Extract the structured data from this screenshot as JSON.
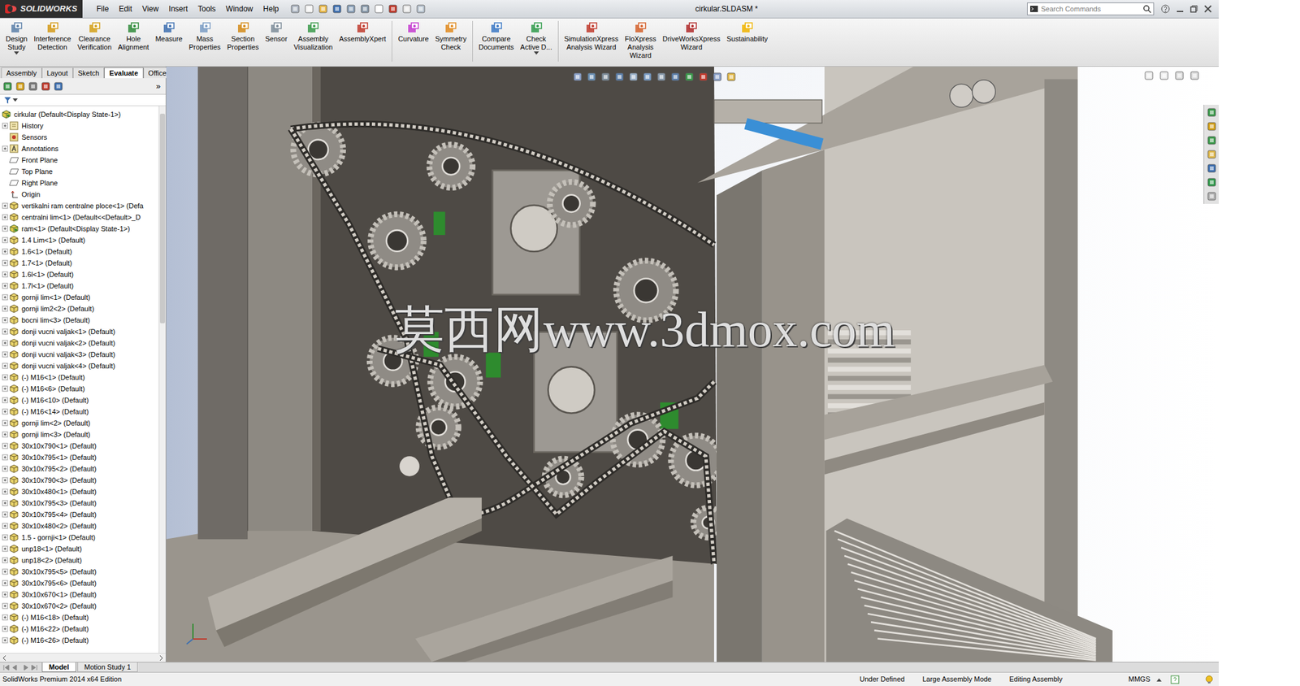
{
  "app": {
    "logo": "SOLIDWORKS",
    "title": "cirkular.SLDASM *"
  },
  "menu": [
    "File",
    "Edit",
    "View",
    "Insert",
    "Tools",
    "Window",
    "Help"
  ],
  "search": {
    "placeholder": "Search Commands"
  },
  "toolbar": [
    {
      "lines": [
        "Design",
        "Study"
      ],
      "dropdown": true,
      "separator_before": false
    },
    {
      "lines": [
        "Interference",
        "Detection"
      ],
      "dropdown": false,
      "separator_before": false
    },
    {
      "lines": [
        "Clearance",
        "Verification"
      ],
      "dropdown": false,
      "separator_before": false
    },
    {
      "lines": [
        "Hole",
        "Alignment"
      ],
      "dropdown": false,
      "separator_before": false
    },
    {
      "lines": [
        "Measure"
      ],
      "dropdown": false,
      "separator_before": false
    },
    {
      "lines": [
        "Mass",
        "Properties"
      ],
      "dropdown": false,
      "separator_before": false
    },
    {
      "lines": [
        "Section",
        "Properties"
      ],
      "dropdown": false,
      "separator_before": false
    },
    {
      "lines": [
        "Sensor"
      ],
      "dropdown": false,
      "separator_before": false
    },
    {
      "lines": [
        "Assembly",
        "Visualization"
      ],
      "dropdown": false,
      "separator_before": false
    },
    {
      "lines": [
        "AssemblyXpert"
      ],
      "dropdown": false,
      "separator_before": false
    },
    {
      "lines": [
        "Curvature"
      ],
      "dropdown": false,
      "separator_before": true
    },
    {
      "lines": [
        "Symmetry",
        "Check"
      ],
      "dropdown": false,
      "separator_before": false
    },
    {
      "lines": [
        "Compare",
        "Documents"
      ],
      "dropdown": false,
      "separator_before": true
    },
    {
      "lines": [
        "Check",
        "Active D..."
      ],
      "dropdown": true,
      "separator_before": false
    },
    {
      "lines": [
        "SimulationXpress",
        "Analysis Wizard"
      ],
      "dropdown": false,
      "separator_before": true
    },
    {
      "lines": [
        "FloXpress",
        "Analysis",
        "Wizard"
      ],
      "dropdown": false,
      "separator_before": false
    },
    {
      "lines": [
        "DriveWorksXpress",
        "Wizard"
      ],
      "dropdown": false,
      "separator_before": false
    },
    {
      "lines": [
        "Sustainability"
      ],
      "dropdown": false,
      "separator_before": false
    }
  ],
  "tabs": [
    {
      "label": "Assembly",
      "selected": false
    },
    {
      "label": "Layout",
      "selected": false
    },
    {
      "label": "Sketch",
      "selected": false
    },
    {
      "label": "Evaluate",
      "selected": true
    },
    {
      "label": "Office Products",
      "selected": false
    }
  ],
  "panel_overflow": "»",
  "tree": {
    "root": "cirkular  (Default<Display State-1>)",
    "items": [
      {
        "label": "History",
        "kind": "history",
        "expandable": true
      },
      {
        "label": "Sensors",
        "kind": "sensors",
        "expandable": false
      },
      {
        "label": "Annotations",
        "kind": "annotations",
        "expandable": true
      },
      {
        "label": "Front Plane",
        "kind": "plane",
        "expandable": false
      },
      {
        "label": "Top Plane",
        "kind": "plane",
        "expandable": false
      },
      {
        "label": "Right Plane",
        "kind": "plane",
        "expandable": false
      },
      {
        "label": "Origin",
        "kind": "origin",
        "expandable": false
      },
      {
        "label": "vertikalni ram centralne ploce<1> (Defa",
        "kind": "part",
        "expandable": true
      },
      {
        "label": "centralni lim<1> (Default<<Default>_D",
        "kind": "part",
        "expandable": true
      },
      {
        "label": "ram<1> (Default<Display State-1>)",
        "kind": "assembly",
        "expandable": true
      },
      {
        "label": "1.4 Lim<1> (Default)",
        "kind": "part",
        "expandable": true
      },
      {
        "label": "1.6<1> (Default)",
        "kind": "part",
        "expandable": true
      },
      {
        "label": "1.7<1> (Default)",
        "kind": "part",
        "expandable": true
      },
      {
        "label": "1.6l<1> (Default)",
        "kind": "part",
        "expandable": true
      },
      {
        "label": "1.7l<1> (Default)",
        "kind": "part",
        "expandable": true
      },
      {
        "label": "gornji lim<1> (Default)",
        "kind": "part",
        "expandable": true
      },
      {
        "label": "gornji lim2<2> (Default)",
        "kind": "part",
        "expandable": true
      },
      {
        "label": "bocni lim<3> (Default)",
        "kind": "part",
        "expandable": true
      },
      {
        "label": "donji vucni valjak<1> (Default)",
        "kind": "part",
        "expandable": true
      },
      {
        "label": "donji vucni valjak<2> (Default)",
        "kind": "part",
        "expandable": true
      },
      {
        "label": "donji vucni valjak<3> (Default)",
        "kind": "part",
        "expandable": true
      },
      {
        "label": "donji vucni valjak<4> (Default)",
        "kind": "part",
        "expandable": true
      },
      {
        "label": "(-) M16<1> (Default)",
        "kind": "part",
        "expandable": true
      },
      {
        "label": "(-) M16<6> (Default)",
        "kind": "part",
        "expandable": true
      },
      {
        "label": "(-) M16<10> (Default)",
        "kind": "part",
        "expandable": true
      },
      {
        "label": "(-) M16<14> (Default)",
        "kind": "part",
        "expandable": true
      },
      {
        "label": "gornji lim<2> (Default)",
        "kind": "part",
        "expandable": true
      },
      {
        "label": "gornji lim<3> (Default)",
        "kind": "part",
        "expandable": true
      },
      {
        "label": "30x10x790<1> (Default)",
        "kind": "part",
        "expandable": true
      },
      {
        "label": "30x10x795<1> (Default)",
        "kind": "part",
        "expandable": true
      },
      {
        "label": "30x10x795<2> (Default)",
        "kind": "part",
        "expandable": true
      },
      {
        "label": "30x10x790<3> (Default)",
        "kind": "part",
        "expandable": true
      },
      {
        "label": "30x10x480<1> (Default)",
        "kind": "part",
        "expandable": true
      },
      {
        "label": "30x10x795<3> (Default)",
        "kind": "part",
        "expandable": true
      },
      {
        "label": "30x10x795<4> (Default)",
        "kind": "part",
        "expandable": true
      },
      {
        "label": "30x10x480<2> (Default)",
        "kind": "part",
        "expandable": true
      },
      {
        "label": "1.5 - gornji<1> (Default)",
        "kind": "part",
        "expandable": true
      },
      {
        "label": "unp18<1> (Default)",
        "kind": "part",
        "expandable": true
      },
      {
        "label": "unp18<2> (Default)",
        "kind": "part",
        "expandable": true
      },
      {
        "label": "30x10x795<5> (Default)",
        "kind": "part",
        "expandable": true
      },
      {
        "label": "30x10x795<6> (Default)",
        "kind": "part",
        "expandable": true
      },
      {
        "label": "30x10x670<1> (Default)",
        "kind": "part",
        "expandable": true
      },
      {
        "label": "30x10x670<2> (Default)",
        "kind": "part",
        "expandable": true
      },
      {
        "label": "(-) M16<18> (Default)",
        "kind": "part",
        "expandable": true
      },
      {
        "label": "(-) M16<22> (Default)",
        "kind": "part",
        "expandable": true
      },
      {
        "label": "(-) M16<26> (Default)",
        "kind": "part",
        "expandable": true
      }
    ]
  },
  "bottom_tabs": [
    {
      "label": "Model",
      "selected": true
    },
    {
      "label": "Motion Study 1",
      "selected": false
    }
  ],
  "watermark": "莫西网www.3dmox.com",
  "status_bar": {
    "left": "SolidWorks Premium 2014 x64 Edition",
    "items": [
      "Under Defined",
      "Large Assembly Mode",
      "Editing Assembly"
    ],
    "units": "MMGS"
  }
}
